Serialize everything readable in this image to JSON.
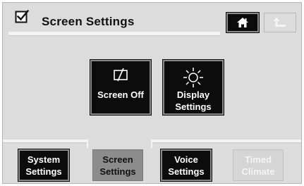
{
  "header": {
    "title": "Screen Settings",
    "checkbox_icon": "checkbox-checked-icon",
    "home_icon": "home-icon",
    "back_icon": "back-arrow-icon"
  },
  "main": {
    "buttons": [
      {
        "line1": "Screen Off",
        "line2": "",
        "icon": "screen-off-icon"
      },
      {
        "line1": "Display",
        "line2": "Settings",
        "icon": "sun-icon"
      }
    ]
  },
  "tabs": [
    {
      "line1": "System",
      "line2": "Settings",
      "state": "normal"
    },
    {
      "line1": "Screen",
      "line2": "Settings",
      "state": "active"
    },
    {
      "line1": "Voice",
      "line2": "Settings",
      "state": "normal"
    },
    {
      "line1": "Timed",
      "line2": "Climate",
      "state": "disabled"
    }
  ],
  "colors": {
    "background": "#dcdcdc",
    "button_dark": "#0c0c0c",
    "tab_active": "#8c8c8c",
    "tab_disabled_text": "#f4f4f4"
  }
}
